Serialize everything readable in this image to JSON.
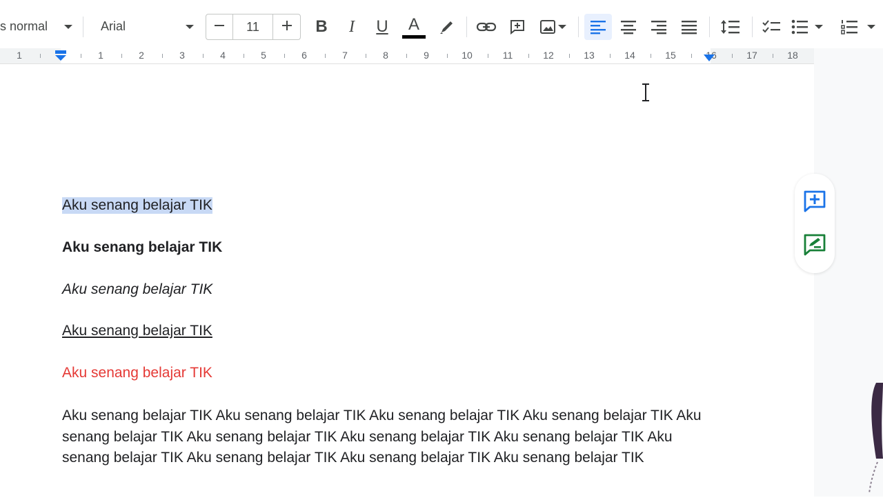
{
  "toolbar": {
    "style_value": "s normal",
    "font_value": "Arial",
    "font_size": "11",
    "bold_label": "B",
    "italic_label": "I",
    "underline_label": "U",
    "text_color_label": "A"
  },
  "ruler": {
    "labels": [
      "1",
      "1",
      "2",
      "3",
      "4",
      "5",
      "6",
      "7",
      "8",
      "9",
      "10",
      "11",
      "12",
      "13",
      "14",
      "15",
      "16",
      "17",
      "18"
    ]
  },
  "document": {
    "lines": [
      "Aku senang belajar TIK",
      "Aku senang belajar TIK",
      "Aku senang belajar TIK",
      "Aku senang belajar TIK",
      "Aku senang belajar TIK"
    ],
    "paragraph": "Aku senang belajar TIK Aku senang belajar TIK Aku senang belajar TIK Aku senang belajar TIK Aku senang belajar TIK Aku senang belajar TIK Aku senang belajar TIK Aku senang belajar TIK Aku senang belajar TIK Aku senang belajar TIK Aku senang belajar TIK Aku senang belajar TIK"
  },
  "colors": {
    "selection_highlight": "#c8d9f5",
    "red_text": "#e53935",
    "active_align_blue": "#1a73e8",
    "comment_blue": "#1a73e8",
    "suggest_green": "#188038"
  }
}
